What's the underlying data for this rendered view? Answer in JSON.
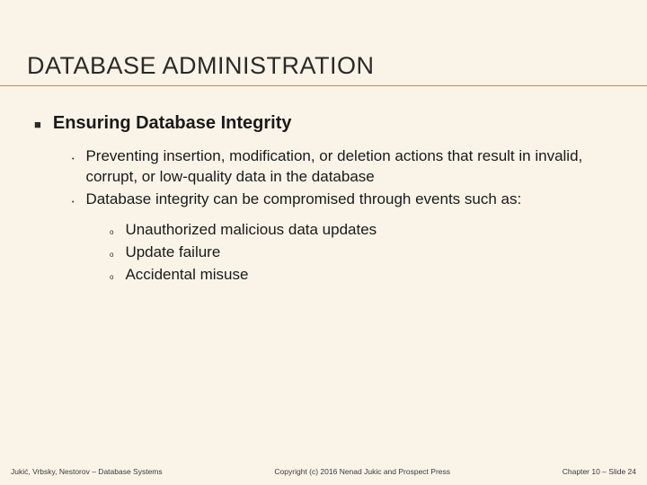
{
  "title": "DATABASE ADMINISTRATION",
  "section_heading": "Ensuring Database Integrity",
  "bullets_level2": [
    "Preventing insertion, modification, or deletion actions that result in invalid, corrupt, or low-quality data in the database",
    "Database integrity can be compromised through events such as:"
  ],
  "bullets_level3": [
    "Unauthorized malicious data updates",
    "Update failure",
    "Accidental misuse"
  ],
  "footer": {
    "left": "Jukić, Vrbsky, Nestorov – Database Systems",
    "center": "Copyright (c) 2016 Nenad Jukic and Prospect Press",
    "right": "Chapter 10 – Slide 24"
  }
}
